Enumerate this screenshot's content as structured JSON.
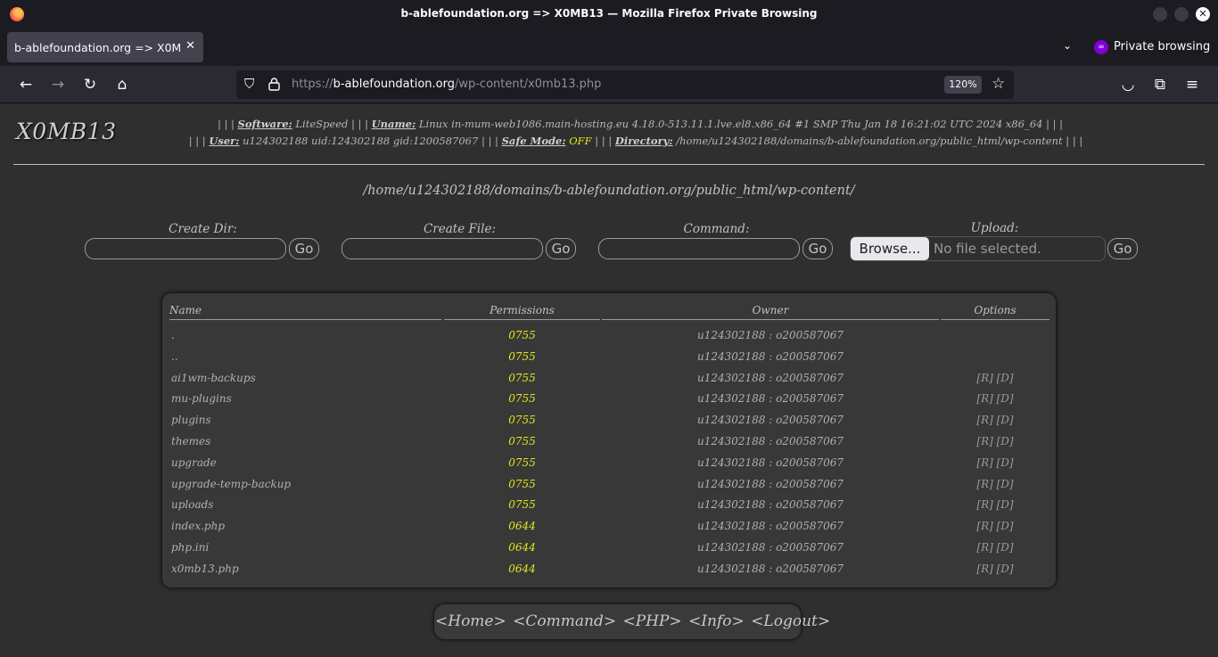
{
  "browser": {
    "window_title": "b-ablefoundation.org => X0MB13 — Mozilla Firefox Private Browsing",
    "tab_title": "b-ablefoundation.org => X0MB13",
    "private_label": "Private browsing",
    "url_prefix": "https://",
    "url_host": "b-ablefoundation.org",
    "url_path": "/wp-content/x0mb13.php",
    "zoom": "120%"
  },
  "shell": {
    "logo": "X0MB13",
    "info": {
      "software_label": "Software:",
      "software": "LiteSpeed",
      "uname_label": "Uname:",
      "uname": "Linux in-mum-web1086.main-hosting.eu 4.18.0-513.11.1.lve.el8.x86_64 #1 SMP Thu Jan 18 16:21:02 UTC 2024 x86_64",
      "user_label": "User:",
      "user": "u124302188 uid:124302188 gid:1200587067",
      "safe_mode_label": "Safe Mode:",
      "safe_mode": "OFF",
      "directory_label": "Directory:",
      "directory": "/home/u124302188/domains/b-ablefoundation.org/public_html/wp-content",
      "sep": "| | |"
    },
    "cwd": "/home/u124302188/domains/b-ablefoundation.org/public_html/wp-content/",
    "forms": {
      "create_dir": "Create Dir:",
      "create_file": "Create File:",
      "command": "Command:",
      "upload": "Upload:",
      "go": "Go",
      "browse": "Browse...",
      "no_file": "No file selected."
    },
    "table": {
      "headers": {
        "name": "Name",
        "permissions": "Permissions",
        "owner": "Owner",
        "options": "Options"
      },
      "rows": [
        {
          "name": ".",
          "perm": "0755",
          "owner": "u124302188 : o200587067",
          "opts": ""
        },
        {
          "name": "..",
          "perm": "0755",
          "owner": "u124302188 : o200587067",
          "opts": ""
        },
        {
          "name": "ai1wm-backups",
          "perm": "0755",
          "owner": "u124302188 : o200587067",
          "opts": "[R] [D]"
        },
        {
          "name": "mu-plugins",
          "perm": "0755",
          "owner": "u124302188 : o200587067",
          "opts": "[R] [D]"
        },
        {
          "name": "plugins",
          "perm": "0755",
          "owner": "u124302188 : o200587067",
          "opts": "[R] [D]"
        },
        {
          "name": "themes",
          "perm": "0755",
          "owner": "u124302188 : o200587067",
          "opts": "[R] [D]"
        },
        {
          "name": "upgrade",
          "perm": "0755",
          "owner": "u124302188 : o200587067",
          "opts": "[R] [D]"
        },
        {
          "name": "upgrade-temp-backup",
          "perm": "0755",
          "owner": "u124302188 : o200587067",
          "opts": "[R] [D]"
        },
        {
          "name": "uploads",
          "perm": "0755",
          "owner": "u124302188 : o200587067",
          "opts": "[R] [D]"
        },
        {
          "name": "index.php",
          "perm": "0644",
          "owner": "u124302188 : o200587067",
          "opts": "[R] [D]"
        },
        {
          "name": "php.ini",
          "perm": "0644",
          "owner": "u124302188 : o200587067",
          "opts": "[R] [D]"
        },
        {
          "name": "x0mb13.php",
          "perm": "0644",
          "owner": "u124302188 : o200587067",
          "opts": "[R] [D]"
        }
      ]
    },
    "menu": [
      "<Home>",
      "<Command>",
      "<PHP>",
      "<Info>",
      "<Logout>"
    ]
  },
  "colors": {
    "accent_yellow": "#dfe81c",
    "page_bg": "#2f2f2f",
    "private_purple": "#8000d7"
  }
}
